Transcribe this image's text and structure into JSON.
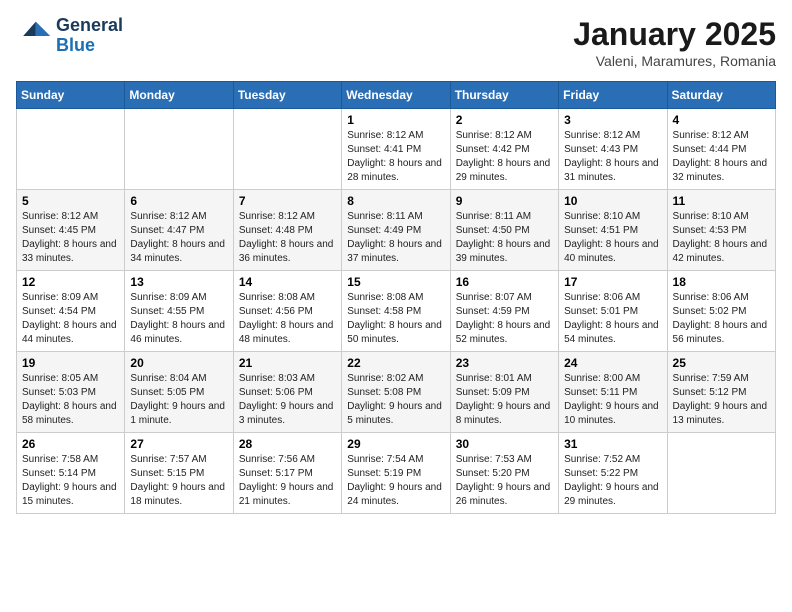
{
  "header": {
    "logo_general": "General",
    "logo_blue": "Blue",
    "title": "January 2025",
    "subtitle": "Valeni, Maramures, Romania"
  },
  "weekdays": [
    "Sunday",
    "Monday",
    "Tuesday",
    "Wednesday",
    "Thursday",
    "Friday",
    "Saturday"
  ],
  "weeks": [
    [
      {
        "num": "",
        "sunrise": "",
        "sunset": "",
        "daylight": ""
      },
      {
        "num": "",
        "sunrise": "",
        "sunset": "",
        "daylight": ""
      },
      {
        "num": "",
        "sunrise": "",
        "sunset": "",
        "daylight": ""
      },
      {
        "num": "1",
        "sunrise": "8:12 AM",
        "sunset": "4:41 PM",
        "daylight": "8 hours and 28 minutes."
      },
      {
        "num": "2",
        "sunrise": "8:12 AM",
        "sunset": "4:42 PM",
        "daylight": "8 hours and 29 minutes."
      },
      {
        "num": "3",
        "sunrise": "8:12 AM",
        "sunset": "4:43 PM",
        "daylight": "8 hours and 31 minutes."
      },
      {
        "num": "4",
        "sunrise": "8:12 AM",
        "sunset": "4:44 PM",
        "daylight": "8 hours and 32 minutes."
      }
    ],
    [
      {
        "num": "5",
        "sunrise": "8:12 AM",
        "sunset": "4:45 PM",
        "daylight": "8 hours and 33 minutes."
      },
      {
        "num": "6",
        "sunrise": "8:12 AM",
        "sunset": "4:47 PM",
        "daylight": "8 hours and 34 minutes."
      },
      {
        "num": "7",
        "sunrise": "8:12 AM",
        "sunset": "4:48 PM",
        "daylight": "8 hours and 36 minutes."
      },
      {
        "num": "8",
        "sunrise": "8:11 AM",
        "sunset": "4:49 PM",
        "daylight": "8 hours and 37 minutes."
      },
      {
        "num": "9",
        "sunrise": "8:11 AM",
        "sunset": "4:50 PM",
        "daylight": "8 hours and 39 minutes."
      },
      {
        "num": "10",
        "sunrise": "8:10 AM",
        "sunset": "4:51 PM",
        "daylight": "8 hours and 40 minutes."
      },
      {
        "num": "11",
        "sunrise": "8:10 AM",
        "sunset": "4:53 PM",
        "daylight": "8 hours and 42 minutes."
      }
    ],
    [
      {
        "num": "12",
        "sunrise": "8:09 AM",
        "sunset": "4:54 PM",
        "daylight": "8 hours and 44 minutes."
      },
      {
        "num": "13",
        "sunrise": "8:09 AM",
        "sunset": "4:55 PM",
        "daylight": "8 hours and 46 minutes."
      },
      {
        "num": "14",
        "sunrise": "8:08 AM",
        "sunset": "4:56 PM",
        "daylight": "8 hours and 48 minutes."
      },
      {
        "num": "15",
        "sunrise": "8:08 AM",
        "sunset": "4:58 PM",
        "daylight": "8 hours and 50 minutes."
      },
      {
        "num": "16",
        "sunrise": "8:07 AM",
        "sunset": "4:59 PM",
        "daylight": "8 hours and 52 minutes."
      },
      {
        "num": "17",
        "sunrise": "8:06 AM",
        "sunset": "5:01 PM",
        "daylight": "8 hours and 54 minutes."
      },
      {
        "num": "18",
        "sunrise": "8:06 AM",
        "sunset": "5:02 PM",
        "daylight": "8 hours and 56 minutes."
      }
    ],
    [
      {
        "num": "19",
        "sunrise": "8:05 AM",
        "sunset": "5:03 PM",
        "daylight": "8 hours and 58 minutes."
      },
      {
        "num": "20",
        "sunrise": "8:04 AM",
        "sunset": "5:05 PM",
        "daylight": "9 hours and 1 minute."
      },
      {
        "num": "21",
        "sunrise": "8:03 AM",
        "sunset": "5:06 PM",
        "daylight": "9 hours and 3 minutes."
      },
      {
        "num": "22",
        "sunrise": "8:02 AM",
        "sunset": "5:08 PM",
        "daylight": "9 hours and 5 minutes."
      },
      {
        "num": "23",
        "sunrise": "8:01 AM",
        "sunset": "5:09 PM",
        "daylight": "9 hours and 8 minutes."
      },
      {
        "num": "24",
        "sunrise": "8:00 AM",
        "sunset": "5:11 PM",
        "daylight": "9 hours and 10 minutes."
      },
      {
        "num": "25",
        "sunrise": "7:59 AM",
        "sunset": "5:12 PM",
        "daylight": "9 hours and 13 minutes."
      }
    ],
    [
      {
        "num": "26",
        "sunrise": "7:58 AM",
        "sunset": "5:14 PM",
        "daylight": "9 hours and 15 minutes."
      },
      {
        "num": "27",
        "sunrise": "7:57 AM",
        "sunset": "5:15 PM",
        "daylight": "9 hours and 18 minutes."
      },
      {
        "num": "28",
        "sunrise": "7:56 AM",
        "sunset": "5:17 PM",
        "daylight": "9 hours and 21 minutes."
      },
      {
        "num": "29",
        "sunrise": "7:54 AM",
        "sunset": "5:19 PM",
        "daylight": "9 hours and 24 minutes."
      },
      {
        "num": "30",
        "sunrise": "7:53 AM",
        "sunset": "5:20 PM",
        "daylight": "9 hours and 26 minutes."
      },
      {
        "num": "31",
        "sunrise": "7:52 AM",
        "sunset": "5:22 PM",
        "daylight": "9 hours and 29 minutes."
      },
      {
        "num": "",
        "sunrise": "",
        "sunset": "",
        "daylight": ""
      }
    ]
  ]
}
